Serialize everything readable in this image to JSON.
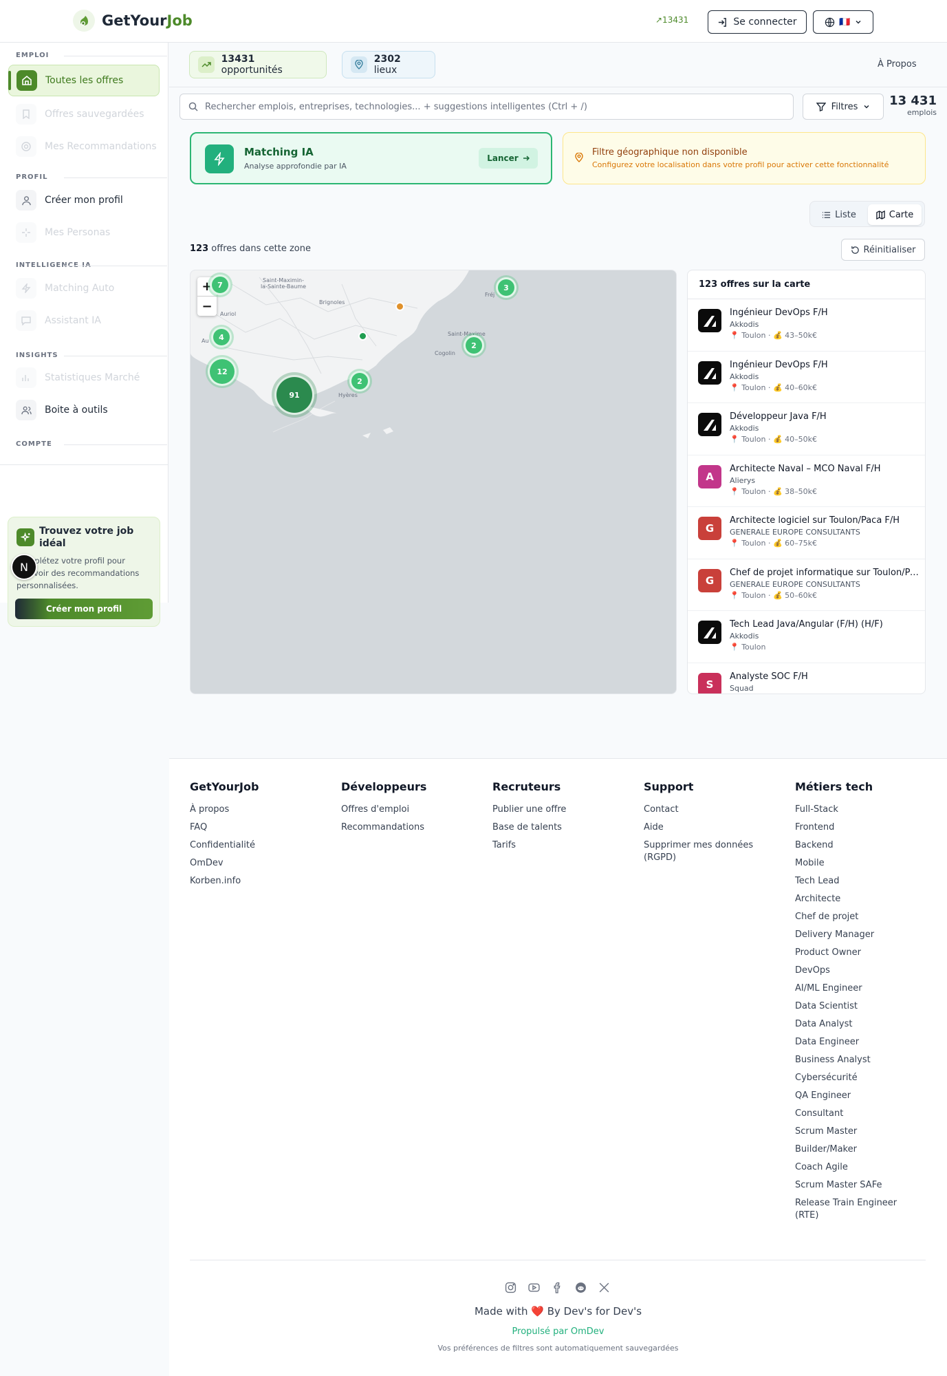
{
  "header": {
    "brand_prefix": "GetYour",
    "brand_accent": "Job",
    "count": "↗13431",
    "login_label": "Se connecter",
    "lang_flag": "🇫🇷"
  },
  "sidebar": {
    "sections": {
      "emploi": "EMPLOI",
      "profil": "PROFIL",
      "ia": "INTELLIGENCE IA",
      "insights": "INSIGHTS",
      "compte": "COMPTE"
    },
    "items": [
      {
        "label": "Toutes les offres",
        "icon": "home-icon",
        "state": "active"
      },
      {
        "label": "Offres sauvegardées",
        "icon": "bookmark-icon",
        "state": "disabled"
      },
      {
        "label": "Mes Recommandations",
        "icon": "target-icon",
        "state": "disabled"
      },
      {
        "label": "Créer mon profil",
        "icon": "user-icon",
        "state": "normal"
      },
      {
        "label": "Mes Personas",
        "icon": "sparkles-icon",
        "state": "disabled"
      },
      {
        "label": "Matching Auto",
        "icon": "bolt-icon",
        "state": "disabled"
      },
      {
        "label": "Assistant IA",
        "icon": "chat-icon",
        "state": "disabled"
      },
      {
        "label": "Statistiques Marché",
        "icon": "chart-icon",
        "state": "disabled"
      },
      {
        "label": "Boite à outils",
        "icon": "users-icon",
        "state": "normal"
      }
    ],
    "promo": {
      "title": "Trouvez votre job idéal",
      "text": "Complétez votre profil pour recevoir des recommandations personnalisées.",
      "button": "Créer mon profil",
      "badge": "N"
    }
  },
  "stats": {
    "opportunities_value": "13431",
    "opportunities_label": "opportunités",
    "places_value": "2302",
    "places_label": "lieux",
    "about": "À Propos"
  },
  "search": {
    "placeholder": "Rechercher emplois, entreprises, technologies... + suggestions intelligentes (Ctrl + /)",
    "filters_label": "Filtres",
    "jobs_count": "13 431",
    "jobs_label": "emplois"
  },
  "matching": {
    "title": "Matching IA",
    "subtitle": "Analyse approfondie par IA",
    "button": "Lancer"
  },
  "geo_notice": {
    "title": "Filtre géographique non disponible",
    "subtitle": "Configurez votre localisation dans votre profil pour activer cette fonctionnalité"
  },
  "view_toggle": {
    "list": "Liste",
    "map": "Carte",
    "selected": "map"
  },
  "zone": {
    "count": "123",
    "label": "offres dans cette zone",
    "reset": "Réinitialiser"
  },
  "map": {
    "zoom_in": "+",
    "zoom_out": "−",
    "clusters": [
      "7",
      "3",
      "4",
      "2",
      "12",
      "91",
      "2"
    ],
    "places": [
      "Saint-Maximin-la-Sainte-Baume",
      "Brignoles",
      "Auriol",
      "Au",
      "Saint-Maxime",
      "Cogolin",
      "Hyères",
      "Fréj"
    ]
  },
  "offers": {
    "header": "123 offres sur la carte",
    "items": [
      {
        "title": "Ingénieur DevOps F/H",
        "company": "Akkodis",
        "meta": "📍 Toulon · 💰 43–50k€",
        "logo": "",
        "color": "#0b0b0b"
      },
      {
        "title": "Ingénieur DevOps F/H",
        "company": "Akkodis",
        "meta": "📍 Toulon · 💰 40–60k€",
        "logo": "",
        "color": "#0b0b0b"
      },
      {
        "title": "Développeur Java F/H",
        "company": "Akkodis",
        "meta": "📍 Toulon · 💰 40–50k€",
        "logo": "",
        "color": "#0b0b0b"
      },
      {
        "title": "Architecte Naval – MCO Naval F/H",
        "company": "Alierys",
        "meta": "📍 Toulon · 💰 38–50k€",
        "logo": "A",
        "color": "#c2368a"
      },
      {
        "title": "Architecte logiciel sur Toulon/Paca F/H",
        "company": "GENERALE EUROPE CONSULTANTS",
        "meta": "📍 Toulon · 💰 60–75k€",
        "logo": "G",
        "color": "#c9403a"
      },
      {
        "title": "Chef de projet informatique sur Toulon/Paca F/H",
        "company": "GENERALE EUROPE CONSULTANTS",
        "meta": "📍 Toulon · 💰 50–60k€",
        "logo": "G",
        "color": "#c9403a"
      },
      {
        "title": "Tech Lead Java/Angular (F/H) (H/F)",
        "company": "Akkodis",
        "meta": "📍 Toulon",
        "logo": "",
        "color": "#0b0b0b"
      },
      {
        "title": "Analyste SOC F/H",
        "company": "Squad",
        "meta": "",
        "logo": "S",
        "color": "#c9305a"
      }
    ]
  },
  "footer": {
    "columns": [
      {
        "title": "GetYourJob",
        "links": [
          "À propos",
          "FAQ",
          "Confidentialité",
          "OmDev",
          "Korben.info"
        ]
      },
      {
        "title": "Développeurs",
        "links": [
          "Offres d'emploi",
          "Recommandations"
        ]
      },
      {
        "title": "Recruteurs",
        "links": [
          "Publier une offre",
          "Base de talents",
          "Tarifs"
        ]
      },
      {
        "title": "Support",
        "links": [
          "Contact",
          "Aide",
          "Supprimer mes données (RGPD)"
        ]
      },
      {
        "title": "Métiers tech",
        "links": [
          "Full-Stack",
          "Frontend",
          "Backend",
          "Mobile",
          "Tech Lead",
          "Architecte",
          "Chef de projet",
          "Delivery Manager",
          "Product Owner",
          "DevOps",
          "AI/ML Engineer",
          "Data Scientist",
          "Data Analyst",
          "Data Engineer",
          "Business Analyst",
          "Cybersécurité",
          "QA Engineer",
          "Consultant",
          "Scrum Master",
          "Builder/Maker",
          "Coach Agile",
          "Scrum Master SAFe",
          "Release Train Engineer (RTE)"
        ]
      }
    ],
    "made_with": "Made with",
    "heart": "❤️",
    "by": "By Dev's for Dev's",
    "powered": "Propulsé par OmDev",
    "prefs": "Vos préférences de filtres sont automatiquement sauvegardées"
  }
}
